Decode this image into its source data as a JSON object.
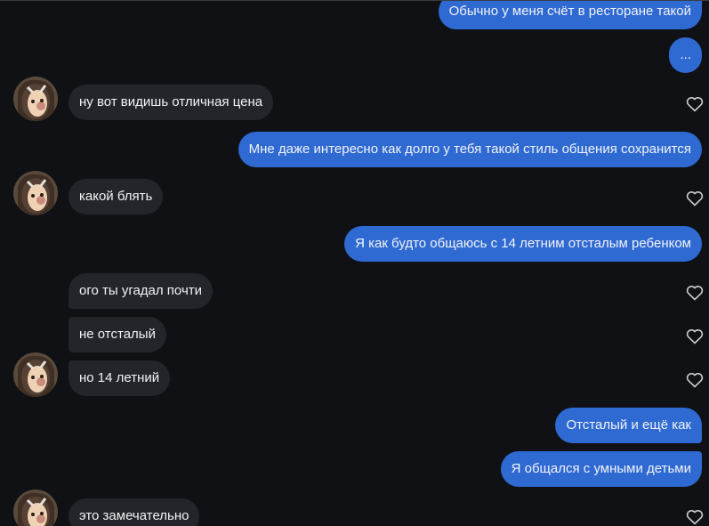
{
  "messages": [
    {
      "id": "m1",
      "dir": "out",
      "text": "Обычно у меня счёт в ресторане такой"
    },
    {
      "id": "m2",
      "dir": "out",
      "text": "..."
    },
    {
      "id": "m3",
      "dir": "in",
      "text": "ну вот видишь отличная цена"
    },
    {
      "id": "m4",
      "dir": "out",
      "text": "Мне даже интересно как долго у тебя такой стиль общения сохранится"
    },
    {
      "id": "m5",
      "dir": "in",
      "text": "какой блять"
    },
    {
      "id": "m6",
      "dir": "out",
      "text": "Я как будто общаюсь с 14 летним отсталым ребенком"
    },
    {
      "id": "m7",
      "dir": "in",
      "text": "ого ты угадал почти"
    },
    {
      "id": "m8",
      "dir": "in",
      "text": "не отсталый"
    },
    {
      "id": "m9",
      "dir": "in",
      "text": "но 14 летний"
    },
    {
      "id": "m10",
      "dir": "out",
      "text": "Отсталый и ещё как"
    },
    {
      "id": "m11",
      "dir": "out",
      "text": "Я общался с умными детьми"
    },
    {
      "id": "m12",
      "dir": "in",
      "text": "это замечательно"
    }
  ],
  "colors": {
    "background": "#0f1115",
    "outgoing_bubble": "#2f6ad3",
    "incoming_bubble": "#23252b",
    "text": "#f2f3f5",
    "heart_outline": "#c9cbd0"
  },
  "icons": {
    "like": "heart-outline-icon",
    "avatar": "contact-avatar"
  }
}
